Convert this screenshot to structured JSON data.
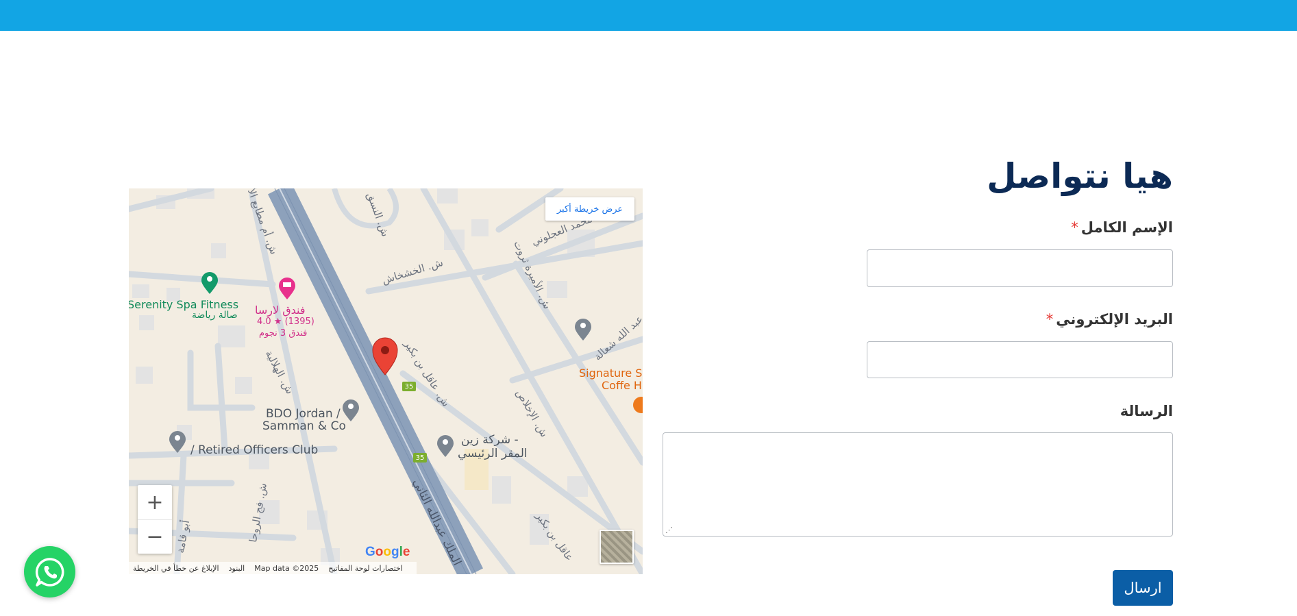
{
  "header": {
    "accent_color": "#12a5e4"
  },
  "contact_form": {
    "title": "هيا نتواصل",
    "fields": [
      {
        "label": "الإسم الكامل",
        "required_mark": "*",
        "value": "",
        "required": true
      },
      {
        "label": "البريد الإلكتروني",
        "required_mark": "*",
        "value": "",
        "required": true
      },
      {
        "label": "الرسالة",
        "value": "",
        "required": false
      }
    ],
    "submit_label": "ارسال",
    "submit_color": "#0b5ea6",
    "title_color": "#0c2a55"
  },
  "map": {
    "larger_map_label": "عرض خريطة أكبر",
    "zoom_in_label": "+",
    "zoom_out_label": "−",
    "google_logo": "Google",
    "attribution": {
      "shortcuts": "اختصارات لوحة المفاتيح",
      "map_data": "Map data ©2025",
      "terms": "البنود",
      "report": "الإبلاغ عن خطأ في الخريطة"
    },
    "pois": {
      "spa_name": "Serenity Spa Fitness",
      "spa_type": "صالة رياضة",
      "hotel_name": "فندق لارسا",
      "hotel_rating": "4.0 ★ (1395)",
      "hotel_type": "فندق 3 نجوم",
      "bdo": "BDO Jordan /",
      "bdo_line2": "Samman & Co",
      "officers_club": "/ Retired Officers Club",
      "zain_line1": "شركة زين -",
      "zain_line2": "المقر الرئيسي",
      "signature_line1": "Signature Sc",
      "signature_line2": "Coffe H"
    },
    "streets": {
      "khashkhash": "ش. الخشخاش",
      "ajlouni": "محمد العجلوني",
      "ameera": "ش. الأميرة ثروت",
      "sha3ala": "عبد الله شعالة",
      "ikhlas": "ش. الإخلاص",
      "aqel1": "ش. عاقل بن بكير",
      "aqel2": "عاقل بن بكير",
      "hilaliya": "ش. الهلالية",
      "matabe3": "ش. أم مطابع الأ",
      "faj": "ش. فج الروحا",
      "abu_qama": "أبو قامة",
      "king_abdullah": "الملك عبدالله الثاني",
      "nasq": "ش. النسق"
    },
    "route_number": "35"
  },
  "whatsapp": {
    "icon": "whatsapp-icon",
    "color": "#25d366"
  }
}
